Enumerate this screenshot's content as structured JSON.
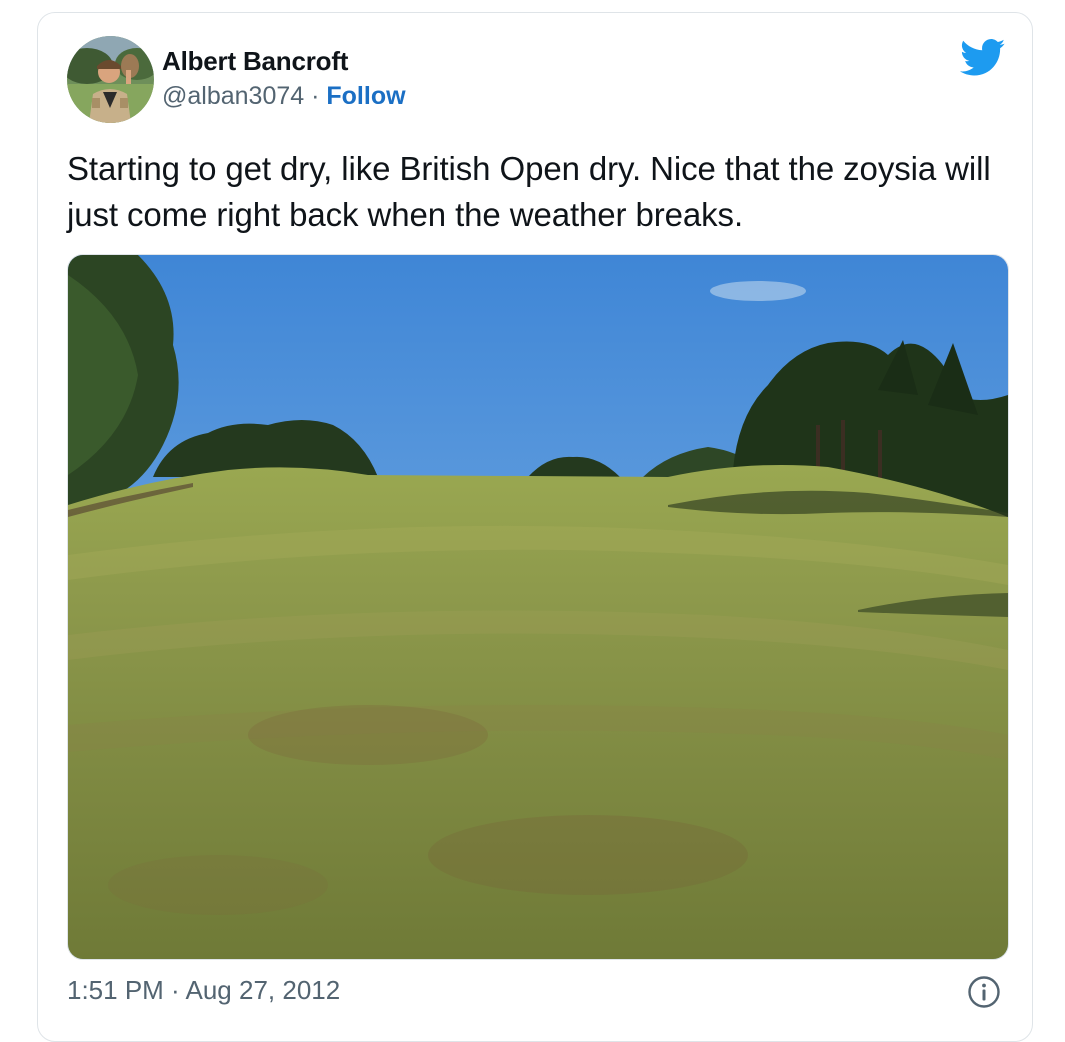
{
  "tweet": {
    "author": {
      "display_name": "Albert Bancroft",
      "handle": "@alban3074",
      "separator": " · ",
      "follow_label": "Follow",
      "avatar_icon": "user-avatar-photo"
    },
    "text": "Starting to get dry, like British Open dry. Nice that the zoysia will just come right back when the weather breaks.",
    "media": {
      "type": "photo",
      "subject": "golf-fairway-photo"
    },
    "timestamp": {
      "time": "1:51 PM",
      "separator": " · ",
      "date": "Aug 27, 2012"
    },
    "icons": {
      "brand": "twitter-bird-icon",
      "info": "info-icon"
    },
    "colors": {
      "link": "#1b6fc4",
      "twitter_blue": "#1d9bf0",
      "secondary_text": "#536471",
      "primary_text": "#0f1419"
    }
  }
}
